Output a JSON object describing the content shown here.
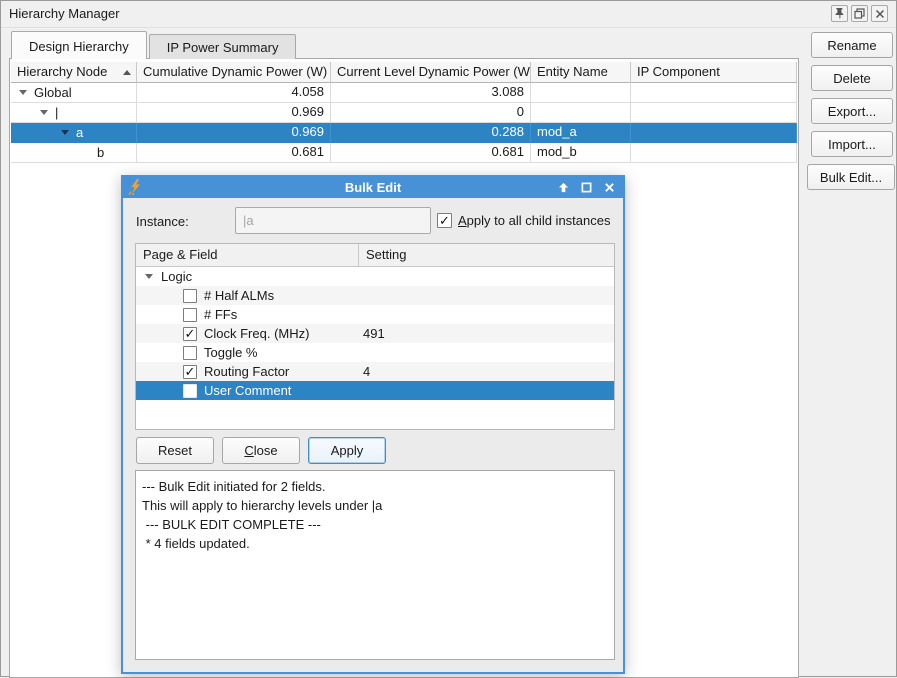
{
  "window": {
    "title": "Hierarchy Manager",
    "controls": [
      {
        "name": "pin",
        "icon": "pin-icon"
      },
      {
        "name": "float",
        "icon": "float-icon"
      },
      {
        "name": "close",
        "icon": "close-icon"
      }
    ]
  },
  "tabs": [
    {
      "label": "Design Hierarchy",
      "active": true
    },
    {
      "label": "IP Power Summary",
      "active": false
    }
  ],
  "table": {
    "columns": [
      "Hierarchy Node",
      "Cumulative Dynamic Power (W)",
      "Current Level Dynamic Power (W)",
      "Entity Name",
      "IP Component"
    ],
    "sort": {
      "column": "Hierarchy Node",
      "direction": "ascending"
    },
    "rows": [
      {
        "node": "Global",
        "indent": 0,
        "expander": true,
        "cumulative": "4.058",
        "current": "3.088",
        "entity": "",
        "ip": "",
        "selected": false
      },
      {
        "node": "|",
        "indent": 1,
        "expander": true,
        "cumulative": "0.969",
        "current": "0",
        "entity": "",
        "ip": "",
        "selected": false
      },
      {
        "node": "a",
        "indent": 2,
        "expander": true,
        "cumulative": "0.969",
        "current": "0.288",
        "entity": "mod_a",
        "ip": "",
        "selected": true
      },
      {
        "node": "b",
        "indent": 3,
        "expander": false,
        "cumulative": "0.681",
        "current": "0.681",
        "entity": "mod_b",
        "ip": "",
        "selected": false
      }
    ]
  },
  "side_buttons": [
    {
      "label": "Rename"
    },
    {
      "label": "Delete"
    },
    {
      "label": "Export..."
    },
    {
      "label": "Import..."
    },
    {
      "label": "Bulk Edit...",
      "wide": true
    }
  ],
  "dialog": {
    "title": "Bulk Edit",
    "app_icon": "power-bolt-icon",
    "controls": [
      {
        "name": "shade",
        "icon": "arrow-up-icon"
      },
      {
        "name": "maximize",
        "icon": "maximize-icon"
      },
      {
        "name": "close",
        "icon": "close-icon"
      }
    ],
    "instance": {
      "label": "Instance:",
      "value": "|a"
    },
    "apply_checkbox": {
      "text": "Apply to all child instances",
      "underline_index": 0,
      "checked": true
    },
    "table": {
      "columns": [
        "Page & Field",
        "Setting"
      ],
      "rows": [
        {
          "label": "Logic",
          "type": "group",
          "setting": "",
          "selected": false
        },
        {
          "label": "# Half ALMs",
          "checked": false,
          "setting": "",
          "selected": false
        },
        {
          "label": "# FFs",
          "checked": false,
          "setting": "",
          "selected": false
        },
        {
          "label": "Clock Freq. (MHz)",
          "checked": true,
          "setting": "491",
          "selected": false
        },
        {
          "label": "Toggle %",
          "checked": false,
          "setting": "",
          "selected": false
        },
        {
          "label": "Routing Factor",
          "checked": true,
          "setting": "4",
          "selected": false
        },
        {
          "label": "User Comment",
          "checked": false,
          "setting": "",
          "selected": true
        }
      ]
    },
    "buttons": [
      {
        "label": "Reset",
        "underline_index": -1,
        "focused": false
      },
      {
        "label": "Close",
        "underline_index": 0,
        "focused": false
      },
      {
        "label": "Apply",
        "underline_index": -1,
        "focused": true
      }
    ],
    "log_lines": [
      "--- Bulk Edit initiated for 2 fields.",
      "This will apply to hierarchy levels under |a",
      " --- BULK EDIT COMPLETE ---",
      " * 4 fields updated."
    ]
  },
  "colors": {
    "selection_blue": "#2d84c5",
    "dialog_title_blue": "#4791d6",
    "bolt_orange": "#f0a232"
  }
}
